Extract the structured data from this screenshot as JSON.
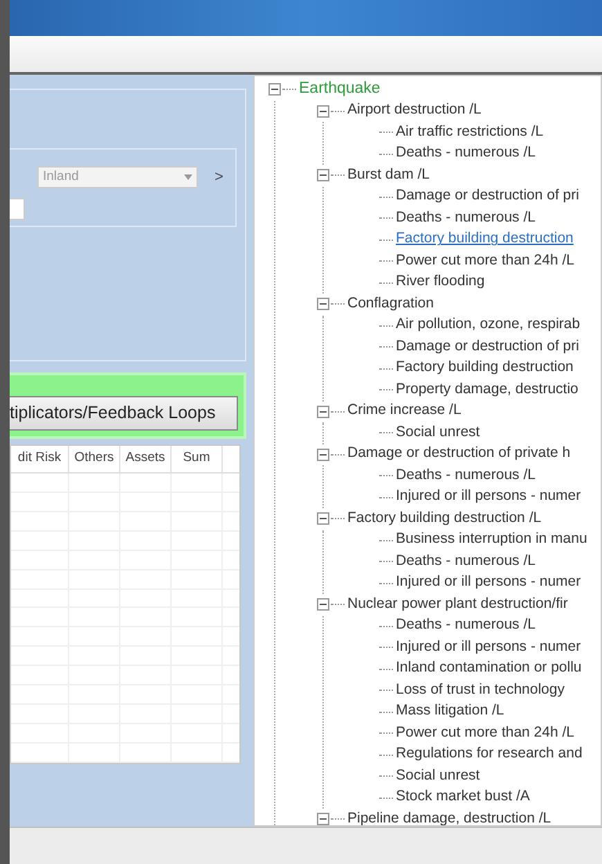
{
  "region_select": {
    "value": "Inland"
  },
  "next_button": ">",
  "multipliers_button": "tiplicators/Feedback Loops",
  "table": {
    "columns": [
      "dit Risk",
      "Others",
      "Assets",
      "Sum"
    ]
  },
  "tree": {
    "label": "Earthquake",
    "expanded": true,
    "children": [
      {
        "label": "Airport destruction  /L",
        "expanded": true,
        "selected": false,
        "children": [
          {
            "label": "Air traffic restrictions  /L",
            "selected": false
          },
          {
            "label": "Deaths - numerous  /L",
            "selected": false
          }
        ]
      },
      {
        "label": "Burst dam  /L",
        "expanded": true,
        "selected": false,
        "children": [
          {
            "label": "Damage or destruction of pri",
            "selected": false
          },
          {
            "label": "Deaths - numerous  /L",
            "selected": false
          },
          {
            "label": "Factory building destruction",
            "selected": true
          },
          {
            "label": "Power cut more than 24h  /L",
            "selected": false
          },
          {
            "label": "River flooding",
            "selected": false
          }
        ]
      },
      {
        "label": "Conflagration",
        "expanded": true,
        "selected": false,
        "children": [
          {
            "label": "Air pollution, ozone, respirab",
            "selected": false
          },
          {
            "label": "Damage or destruction of pri",
            "selected": false
          },
          {
            "label": "Factory building destruction",
            "selected": false
          },
          {
            "label": "Property damage, destructio",
            "selected": false
          }
        ]
      },
      {
        "label": "Crime increase  /L",
        "expanded": true,
        "selected": false,
        "children": [
          {
            "label": "Social unrest",
            "selected": false
          }
        ]
      },
      {
        "label": "Damage or destruction of private h",
        "expanded": true,
        "selected": false,
        "children": [
          {
            "label": "Deaths - numerous  /L",
            "selected": false
          },
          {
            "label": "Injured or ill persons - numer",
            "selected": false
          }
        ]
      },
      {
        "label": "Factory building destruction  /L",
        "expanded": true,
        "selected": false,
        "children": [
          {
            "label": "Business interruption in manu",
            "selected": false
          },
          {
            "label": "Deaths - numerous  /L",
            "selected": false
          },
          {
            "label": "Injured or ill persons - numer",
            "selected": false
          }
        ]
      },
      {
        "label": "Nuclear power plant destruction/fir",
        "expanded": true,
        "selected": false,
        "children": [
          {
            "label": "Deaths - numerous  /L",
            "selected": false
          },
          {
            "label": "Injured or ill persons - numer",
            "selected": false
          },
          {
            "label": "Inland contamination or pollu",
            "selected": false
          },
          {
            "label": "Loss of trust in technology",
            "selected": false
          },
          {
            "label": "Mass litigation  /L",
            "selected": false
          },
          {
            "label": "Power cut more than 24h  /L",
            "selected": false
          },
          {
            "label": "Regulations for research and",
            "selected": false
          },
          {
            "label": "Social unrest",
            "selected": false
          },
          {
            "label": "Stock market bust  /A",
            "selected": false
          }
        ]
      },
      {
        "label": "Pipeline damage, destruction  /L",
        "expanded": true,
        "selected": false
      }
    ]
  }
}
